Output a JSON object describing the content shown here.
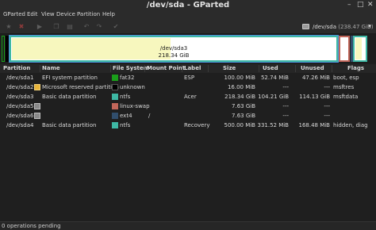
{
  "window": {
    "title": "/dev/sda - GParted"
  },
  "menu": [
    "GParted",
    "Edit",
    "View",
    "Device",
    "Partition",
    "Help"
  ],
  "toolbar": {
    "icons": [
      "new-partition-icon",
      "delete-icon",
      "resize-icon",
      "copy-icon",
      "paste-icon",
      "undo-icon",
      "clear-icon",
      "apply-icon"
    ],
    "device_label": "/dev/sda",
    "device_size": "(238.47 GiB)"
  },
  "disk_map": {
    "selected_partition": "/dev/sda3",
    "selected_size": "218.34 GiB",
    "colors": {
      "fat32": "#1a9e1a",
      "unknown": "#000000",
      "ntfs": "#3eb8a4",
      "linux_swap": "#c1665a",
      "ext4": "#314e6c",
      "used_fill": "#f7f7be",
      "unused_fill": "#ffffff",
      "selection_border": "#4a90d9"
    }
  },
  "columns": [
    "Partition",
    "Name",
    "File System",
    "Mount Point",
    "Label",
    "Size",
    "Used",
    "Unused",
    "Flags"
  ],
  "rows": [
    {
      "partition": "/dev/sda1",
      "warn": false,
      "name": "EFI system partition",
      "fs": "fat32",
      "fs_color": "#1a9e1a",
      "mount": "",
      "label": "ESP",
      "size": "100.00 MiB",
      "used": "52.74 MiB",
      "unused": "47.26 MiB",
      "flags": "boot, esp"
    },
    {
      "partition": "/dev/sda2",
      "warn": true,
      "name": "Microsoft reserved partition",
      "fs": "unknown",
      "fs_color": "#000000",
      "mount": "",
      "label": "",
      "size": "16.00 MiB",
      "used": "---",
      "unused": "---",
      "flags": "msftres"
    },
    {
      "partition": "/dev/sda3",
      "warn": false,
      "name": "Basic data partition",
      "fs": "ntfs",
      "fs_color": "#3eb8a4",
      "mount": "",
      "label": "Acer",
      "size": "218.34 GiB",
      "used": "104.21 GiB",
      "unused": "114.13 GiB",
      "flags": "msftdata"
    },
    {
      "partition": "/dev/sda5",
      "warn": false,
      "lock": true,
      "name": "",
      "fs": "linux-swap",
      "fs_color": "#c1665a",
      "mount": "",
      "label": "",
      "size": "7.63 GiB",
      "used": "---",
      "unused": "---",
      "flags": ""
    },
    {
      "partition": "/dev/sda6",
      "warn": false,
      "lock": true,
      "name": "",
      "fs": "ext4",
      "fs_color": "#314e6c",
      "mount": "/",
      "label": "",
      "size": "7.63 GiB",
      "used": "---",
      "unused": "---",
      "flags": ""
    },
    {
      "partition": "/dev/sda4",
      "warn": false,
      "name": "Basic data partition",
      "fs": "ntfs",
      "fs_color": "#3eb8a4",
      "mount": "",
      "label": "Recovery",
      "size": "500.00 MiB",
      "used": "331.52 MiB",
      "unused": "168.48 MiB",
      "flags": "hidden, diag"
    }
  ],
  "status": {
    "text": "0 operations pending"
  }
}
